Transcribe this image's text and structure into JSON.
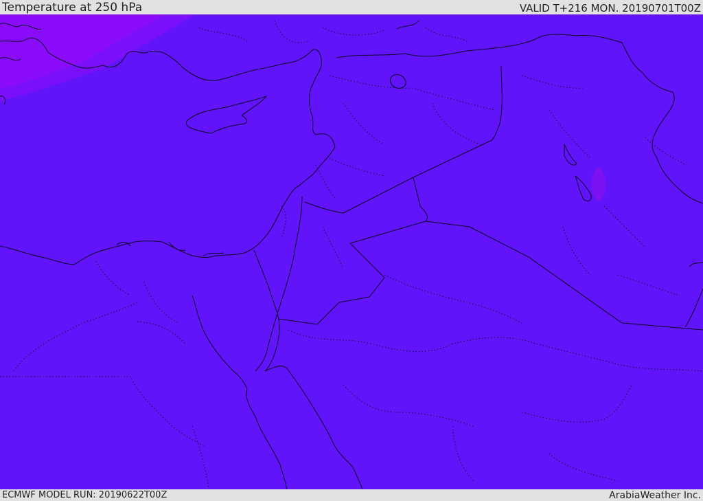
{
  "header": {
    "title": "Temperature at 250 hPa",
    "valid": "VALID T+216 MON. 20190701T00Z"
  },
  "footer": {
    "model_run": "ECMWF MODEL RUN: 20190622T00Z",
    "credit": "ArabiaWeather Inc."
  },
  "colors": {
    "field_main": "#6114fa",
    "field_warm": "#8a0cfa",
    "field_warm_edge": "#7a10fa",
    "field_spot": "#7c12f0",
    "lines": "#0b0620",
    "frame": "#e2e2e2"
  }
}
